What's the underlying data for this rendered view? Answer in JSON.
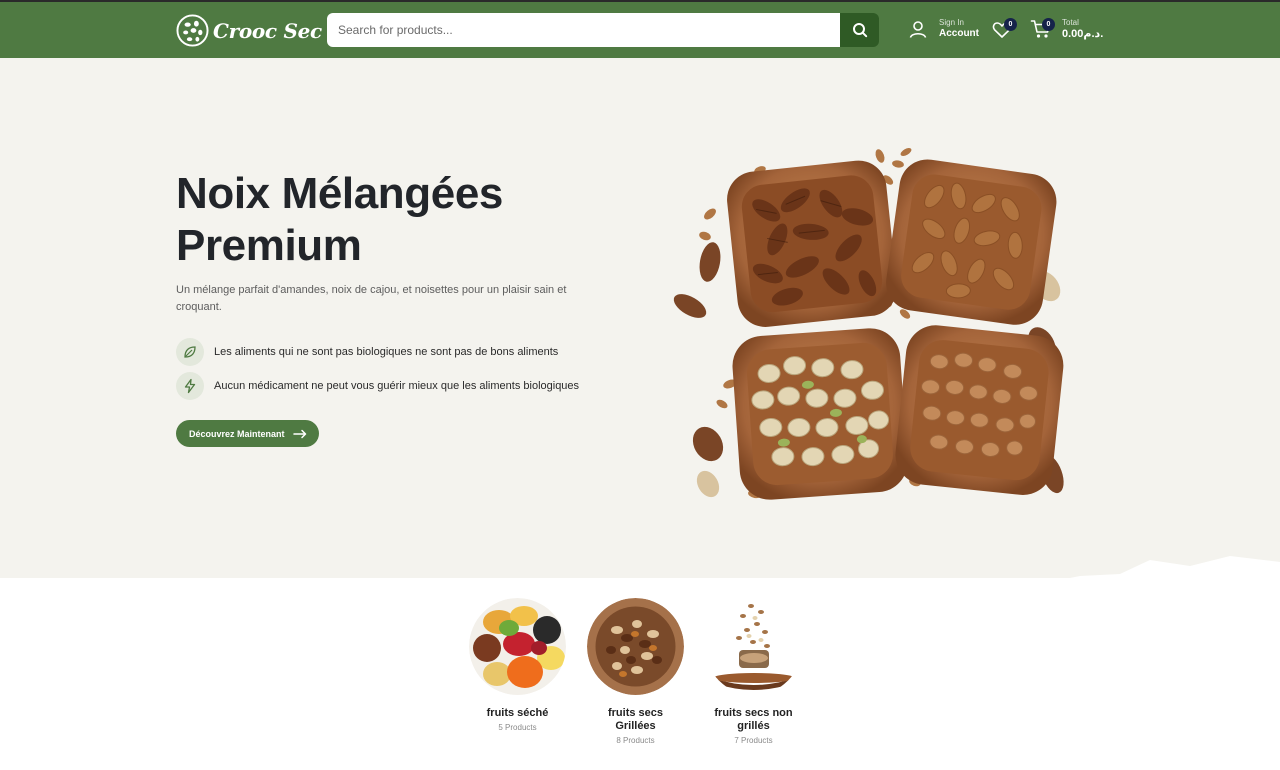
{
  "header": {
    "brand": "Crooc Sec",
    "search_placeholder": "Search for products...",
    "account_small": "Sign In",
    "account_label": "Account",
    "wishlist_count": "0",
    "cart_count": "0",
    "cart_small": "Total",
    "cart_total": "0.00د.م.",
    "icons": [
      "logo-mark",
      "search-icon",
      "user-icon",
      "heart-icon",
      "cart-icon"
    ]
  },
  "hero": {
    "title_line1": "Noix Mélangées",
    "title_line2": "Premium",
    "description": "Un mélange parfait d'amandes, noix de cajou, et noisettes pour un plaisir sain et croquant.",
    "features": [
      {
        "icon": "leaf-icon",
        "text": "Les aliments qui ne sont pas biologiques ne sont pas de bons aliments"
      },
      {
        "icon": "lightning-icon",
        "text": "Aucun médicament ne peut vous guérir mieux que les aliments biologiques"
      }
    ],
    "cta_label": "Découvrez Maintenant"
  },
  "categories": [
    {
      "name": "fruits séché",
      "count": "5 Products"
    },
    {
      "name": "fruits secs Grillées",
      "count": "8 Products"
    },
    {
      "name": "fruits secs non grillés",
      "count": "7 Products"
    }
  ],
  "colors": {
    "brand_green": "#4f7a42",
    "dark_green": "#2f5a25",
    "hero_bg": "#f4f3ee",
    "badge": "#16234a"
  }
}
